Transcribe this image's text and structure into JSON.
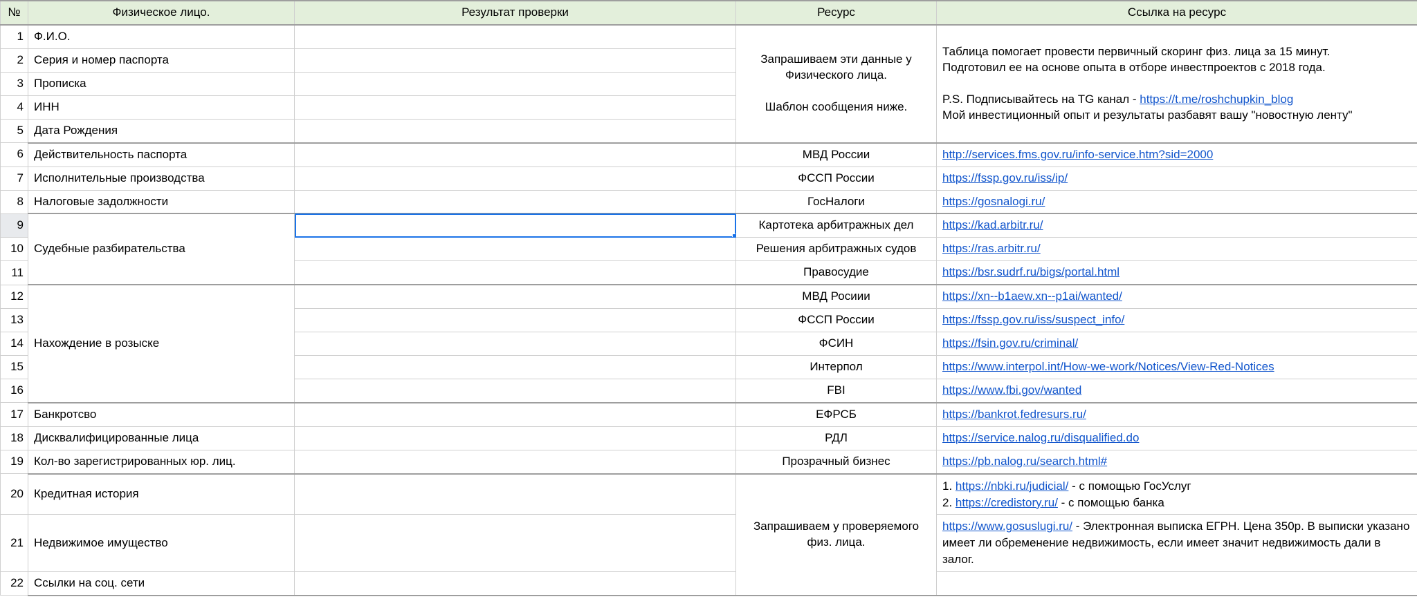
{
  "headers": {
    "num": "№",
    "phys": "Физическое лицо.",
    "res": "Результат проверки",
    "src": "Ресурс",
    "link": "Ссылка на ресурс"
  },
  "active_cell": {
    "row": 9,
    "col": "res"
  },
  "intro_resource": {
    "line1": "Запрашиваем эти данные у Физического лица.",
    "line2": "Шаблон сообщения ниже."
  },
  "intro_link": {
    "l1": "Таблица помогает провести первичный скоринг физ. лица за 15 минут.",
    "l2": "Подготовил ее на основе опыта в отборе инвестпроектов с 2018 года.",
    "l3": "P.S. Подписывайтесь на TG канал - ",
    "l3_link": "https://t.me/roshchupkin_blog",
    "l4": "Мой инвестиционный опыт и результаты разбавят вашу \"новостную ленту\""
  },
  "rows": {
    "1": {
      "phys": "Ф.И.О."
    },
    "2": {
      "phys": "Серия и номер паспорта"
    },
    "3": {
      "phys": "Прописка"
    },
    "4": {
      "phys": "ИНН"
    },
    "5": {
      "phys": "Дата Рождения"
    },
    "6": {
      "phys": "Действительность паспорта",
      "src": "МВД России",
      "link": "http://services.fms.gov.ru/info-service.htm?sid=2000"
    },
    "7": {
      "phys": "Исполнительные производства",
      "src": "ФССП России",
      "link": "https://fssp.gov.ru/iss/ip/"
    },
    "8": {
      "phys": "Налоговые задолжности",
      "src": "ГосНалоги",
      "link": "https://gosnalogi.ru/"
    },
    "9": {
      "src": "Картотека арбитражных дел",
      "link": "https://kad.arbitr.ru/"
    },
    "10": {
      "phys": "Судебные разбирательства",
      "src": "Решения арбитражных судов",
      "link": "https://ras.arbitr.ru/"
    },
    "11": {
      "src": "Правосудие",
      "link": "https://bsr.sudrf.ru/bigs/portal.html"
    },
    "12": {
      "src": "МВД Росиии",
      "link": "https://xn--b1aew.xn--p1ai/wanted/"
    },
    "13": {
      "src": "ФССП России",
      "link": "https://fssp.gov.ru/iss/suspect_info/"
    },
    "14": {
      "phys": "Нахождение в розыске",
      "src": "ФСИН",
      "link": "https://fsin.gov.ru/criminal/"
    },
    "15": {
      "src": "Интерпол",
      "link": "https://www.interpol.int/How-we-work/Notices/View-Red-Notices"
    },
    "16": {
      "src": "FBI",
      "link": "https://www.fbi.gov/wanted"
    },
    "17": {
      "phys": "Банкротсво",
      "src": "ЕФРСБ",
      "link": "https://bankrot.fedresurs.ru/"
    },
    "18": {
      "phys": "Дисквалифицированные лица",
      "src": "РДЛ",
      "link": "https://service.nalog.ru/disqualified.do"
    },
    "19": {
      "phys": "Кол-во зарегистрированных юр. лиц.",
      "src": "Прозрачный бизнес",
      "link": "https://pb.nalog.ru/search.html#"
    },
    "20": {
      "phys": "Кредитная история",
      "l1_pre": "1. ",
      "l1_link": "https://nbki.ru/judicial/",
      "l1_post": "  - с помощью ГосУслуг",
      "l2_pre": "2. ",
      "l2_link": "https://credistory.ru/",
      "l2_post": " - с помощью банка"
    },
    "21": {
      "phys": "Недвижимое имущество",
      "link": "https://www.gosuslugi.ru/",
      "link_post": "  - Электронная выписка ЕГРН. Цена 350р. В выписки указано имеет ли обременение недвижимость, если имеет значит недвижимость дали в залог."
    },
    "22": {
      "phys": "Ссылки на соц. сети"
    },
    "bottom_resource": "Запрашиваем у проверяемого физ. лица."
  }
}
